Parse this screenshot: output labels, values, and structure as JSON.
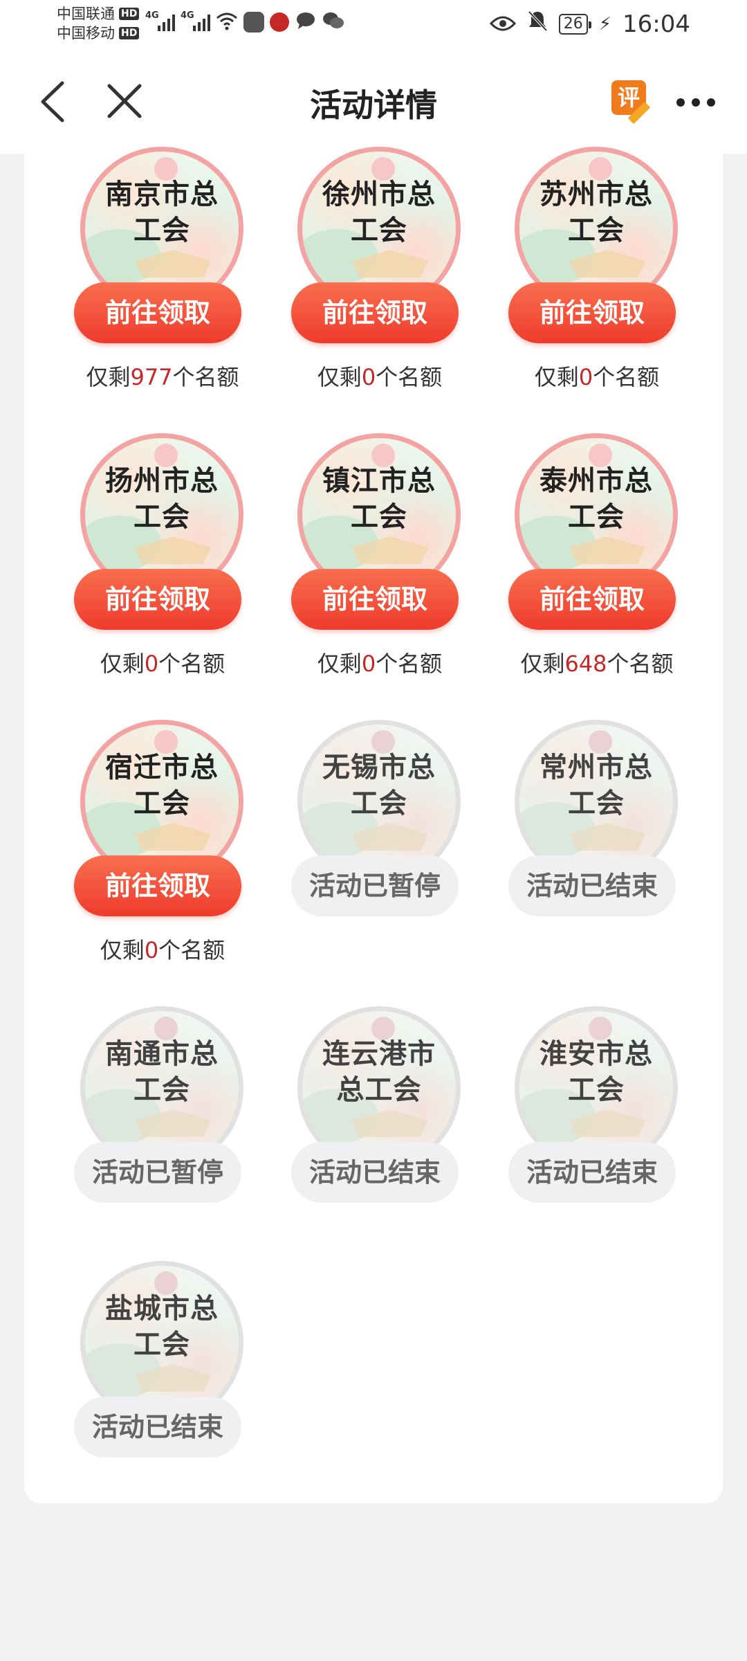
{
  "status_bar": {
    "carrier1": "中国联通",
    "carrier2": "中国移动",
    "hd": "HD",
    "network": "4G",
    "battery": "26",
    "time": "16:04"
  },
  "nav": {
    "title": "活动详情",
    "rate_label": "评"
  },
  "unions": [
    {
      "name": "南京市总工会",
      "button": "前往领取",
      "active": true,
      "remaining_prefix": "仅剩",
      "remaining_count": "977",
      "remaining_suffix": "个名额"
    },
    {
      "name": "徐州市总工会",
      "button": "前往领取",
      "active": true,
      "remaining_prefix": "仅剩",
      "remaining_count": "0",
      "remaining_suffix": "个名额"
    },
    {
      "name": "苏州市总工会",
      "button": "前往领取",
      "active": true,
      "remaining_prefix": "仅剩",
      "remaining_count": "0",
      "remaining_suffix": "个名额"
    },
    {
      "name": "扬州市总工会",
      "button": "前往领取",
      "active": true,
      "remaining_prefix": "仅剩",
      "remaining_count": "0",
      "remaining_suffix": "个名额"
    },
    {
      "name": "镇江市总工会",
      "button": "前往领取",
      "active": true,
      "remaining_prefix": "仅剩",
      "remaining_count": "0",
      "remaining_suffix": "个名额"
    },
    {
      "name": "泰州市总工会",
      "button": "前往领取",
      "active": true,
      "remaining_prefix": "仅剩",
      "remaining_count": "648",
      "remaining_suffix": "个名额"
    },
    {
      "name": "宿迁市总工会",
      "button": "前往领取",
      "active": true,
      "remaining_prefix": "仅剩",
      "remaining_count": "0",
      "remaining_suffix": "个名额"
    },
    {
      "name": "无锡市总工会",
      "button": "活动已暂停",
      "active": false
    },
    {
      "name": "常州市总工会",
      "button": "活动已结束",
      "active": false
    },
    {
      "name": "南通市总工会",
      "button": "活动已暂停",
      "active": false
    },
    {
      "name": "连云港市总工会",
      "button": "活动已结束",
      "active": false
    },
    {
      "name": "淮安市总工会",
      "button": "活动已结束",
      "active": false
    },
    {
      "name": "盐城市总工会",
      "button": "活动已结束",
      "active": false
    }
  ]
}
